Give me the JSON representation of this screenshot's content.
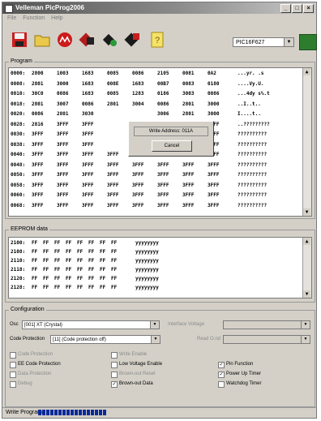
{
  "window": {
    "title": "Velleman PicProg2006"
  },
  "menu": [
    "File",
    "Function",
    "Help"
  ],
  "toolbar": {
    "buttons": [
      "save-icon",
      "open-icon",
      "microchip-logo-icon",
      "program-icon",
      "verify-icon",
      "read-icon",
      "help-icon"
    ],
    "device": "PIC16F627",
    "device_icon": "chip-icon"
  },
  "program": {
    "label": "Program",
    "rows": [
      {
        "addr": "0000:",
        "cells": [
          "2800",
          "1003",
          "1683",
          "0085",
          "0086",
          "2105",
          "0081",
          "0A2"
        ],
        "ascii": "...yr.  .s"
      },
      {
        "addr": "0008:",
        "cells": [
          "2801",
          "3000",
          "1683",
          "008E",
          "1683",
          "00B7",
          "0083",
          "0180"
        ],
        "ascii": "....Vy.U."
      },
      {
        "addr": "0010:",
        "cells": [
          "30C0",
          "0086",
          "1683",
          "0085",
          "1283",
          "0186",
          "3003",
          "0086"
        ],
        "ascii": "...4dy s%.t"
      },
      {
        "addr": "0018:",
        "cells": [
          "2801",
          "3007",
          "0086",
          "2801",
          "3004",
          "0086",
          "2801",
          "3000"
        ],
        "ascii": "..I..t.."
      },
      {
        "addr": "0020:",
        "cells": [
          "0086",
          "2801",
          "3030",
          "",
          "",
          "3006",
          "2801",
          "3000"
        ],
        "ascii": "I....t.."
      },
      {
        "addr": "0028:",
        "cells": [
          "2816",
          "3FFF",
          "3FFF",
          "",
          "",
          "3FFF",
          "3FFF",
          "3FFF"
        ],
        "ascii": "..?????????"
      },
      {
        "addr": "0030:",
        "cells": [
          "3FFF",
          "3FFF",
          "3FFF",
          "",
          "",
          "3FFF",
          "3FFF",
          "3FFF"
        ],
        "ascii": "??????????"
      },
      {
        "addr": "0038:",
        "cells": [
          "3FFF",
          "3FFF",
          "3FFF",
          "",
          "",
          "3FFF",
          "3FFF",
          "3FFF"
        ],
        "ascii": "??????????"
      },
      {
        "addr": "0040:",
        "cells": [
          "3FFF",
          "3FFF",
          "3FFF",
          "3FFF",
          "3FFF",
          "3FFF",
          "3FFF",
          "3FFF"
        ],
        "ascii": "??????????"
      },
      {
        "addr": "0048:",
        "cells": [
          "3FFF",
          "3FFF",
          "3FFF",
          "3FFF",
          "3FFF",
          "3FFF",
          "3FFF",
          "3FFF"
        ],
        "ascii": "??????????"
      },
      {
        "addr": "0050:",
        "cells": [
          "3FFF",
          "3FFF",
          "3FFF",
          "3FFF",
          "3FFF",
          "3FFF",
          "3FFF",
          "3FFF"
        ],
        "ascii": "??????????"
      },
      {
        "addr": "0058:",
        "cells": [
          "3FFF",
          "3FFF",
          "3FFF",
          "3FFF",
          "3FFF",
          "3FFF",
          "3FFF",
          "3FFF"
        ],
        "ascii": "??????????"
      },
      {
        "addr": "0060:",
        "cells": [
          "3FFF",
          "3FFF",
          "3FFF",
          "3FFF",
          "3FFF",
          "3FFF",
          "3FFF",
          "3FFF"
        ],
        "ascii": "??????????"
      },
      {
        "addr": "0068:",
        "cells": [
          "3FFF",
          "3FFF",
          "3FFF",
          "3FFF",
          "3FFF",
          "3FFF",
          "3FFF",
          "3FFF"
        ],
        "ascii": "??????????"
      }
    ]
  },
  "dialog": {
    "text": "Write Address: 011A",
    "button": "Cancel"
  },
  "eeprom": {
    "label": "EEPROM data",
    "rows": [
      {
        "addr": "2100:",
        "cells": [
          "FF",
          "FF",
          "FF",
          "FF",
          "FF",
          "FF",
          "FF",
          "FF"
        ],
        "ascii": "yyyyyyyy"
      },
      {
        "addr": "2108:",
        "cells": [
          "FF",
          "FF",
          "FF",
          "FF",
          "FF",
          "FF",
          "FF",
          "FF"
        ],
        "ascii": "yyyyyyyy"
      },
      {
        "addr": "2110:",
        "cells": [
          "FF",
          "FF",
          "FF",
          "FF",
          "FF",
          "FF",
          "FF",
          "FF"
        ],
        "ascii": "yyyyyyyy"
      },
      {
        "addr": "2118:",
        "cells": [
          "FF",
          "FF",
          "FF",
          "FF",
          "FF",
          "FF",
          "FF",
          "FF"
        ],
        "ascii": "yyyyyyyy"
      },
      {
        "addr": "2120:",
        "cells": [
          "FF",
          "FF",
          "FF",
          "FF",
          "FF",
          "FF",
          "FF",
          "FF"
        ],
        "ascii": "yyyyyyyy"
      },
      {
        "addr": "2128:",
        "cells": [
          "FF",
          "FF",
          "FF",
          "FF",
          "FF",
          "FF",
          "FF",
          "FF"
        ],
        "ascii": "yyyyyyyy"
      }
    ]
  },
  "config": {
    "label": "Configuration",
    "osc_label": "Osc",
    "osc_value": "[001] XT (Crystal)",
    "interface_voltage_label": "Interface Voltage",
    "code_protection_label": "Code Protection",
    "code_protection_value": "[11] (Code protection off)",
    "read_o_label": "Read O.nd",
    "checks": [
      {
        "label": "Code Protection",
        "checked": false,
        "disabled": true
      },
      {
        "label": "EE Code Protection",
        "checked": false,
        "disabled": false
      },
      {
        "label": "Data Protection",
        "checked": false,
        "disabled": true
      },
      {
        "label": "Debug",
        "checked": false,
        "disabled": true
      },
      {
        "label": "Write Enable",
        "checked": false,
        "disabled": true
      },
      {
        "label": "Low Voltage Enable",
        "checked": false,
        "disabled": false
      },
      {
        "label": "Brown-out Reset",
        "checked": false,
        "disabled": true
      },
      {
        "label": "Brown-out Data",
        "checked": true,
        "disabled": false
      },
      {
        "label": "Pin Function",
        "checked": true,
        "disabled": false
      },
      {
        "label": "Power Up Timer",
        "checked": true,
        "disabled": false
      },
      {
        "label": "Watchdog Timer",
        "checked": false,
        "disabled": false
      }
    ]
  },
  "status": {
    "text": "Write Program",
    "progress_segments": 17
  }
}
